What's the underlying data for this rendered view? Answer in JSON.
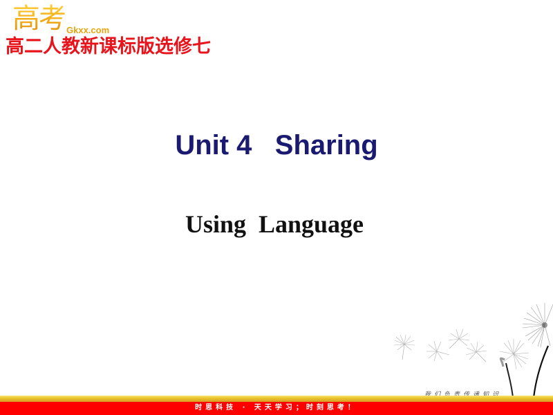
{
  "header": {
    "logo_text": "高考",
    "logo_domain": "Gkxx.com",
    "subject": "高二人教新课标版选修七"
  },
  "slide": {
    "title": "Unit 4   Sharing",
    "subtitle": "Using  Language"
  },
  "decoration": {
    "icon": "dandelion-illustration",
    "tagline": "我们负责传递知识"
  },
  "footer": {
    "text": "时思科技 · 天天学习；时刻思考！",
    "colors": {
      "stripe": "#e8c22a",
      "bar": "#fe0000"
    }
  }
}
